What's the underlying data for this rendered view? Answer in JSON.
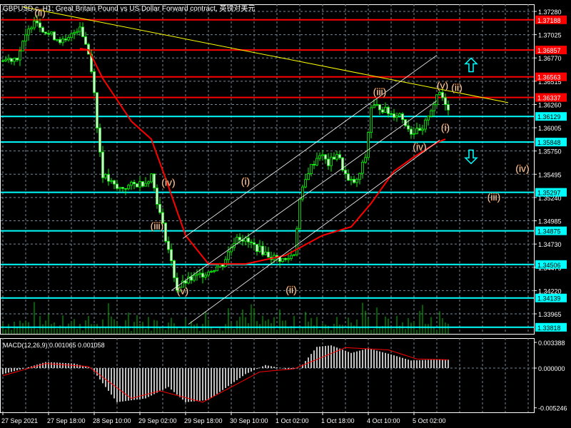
{
  "window_title": "GBPUSD.c, H1:  Great Britain Pound vs US Dollar Forward contract, 英镑对美元",
  "macd_label": "MACD(12,26,9) 0.001065 0.001058",
  "colors": {
    "bull": "#00ff00",
    "bear": "#ffffff",
    "ma": "#ff0000",
    "resistance": "#ff0000",
    "support": "#00ffff",
    "trend": "#ffff00",
    "channel": "#ffffff",
    "grid": "#778899",
    "wave": "#ffffff"
  },
  "chart_data": {
    "type": "candlestick",
    "symbol": "GBPUSD.c",
    "timeframe": "H1",
    "ylim": [
      1.337,
      1.3735
    ],
    "price_ticks": [
      "1.37280",
      "1.37025",
      "1.36770",
      "1.36515",
      "1.36260",
      "1.36005",
      "1.35750",
      "1.35495",
      "1.35240",
      "1.34985",
      "1.34730",
      "1.34475",
      "1.34220",
      "1.33965"
    ],
    "x_ticks": [
      {
        "bar": 0,
        "label": "27 Sep 2021"
      },
      {
        "bar": 16,
        "label": "27 Sep 18:00"
      },
      {
        "bar": 32,
        "label": "28 Sep 10:00"
      },
      {
        "bar": 48,
        "label": "29 Sep 02:00"
      },
      {
        "bar": 64,
        "label": "29 Sep 18:00"
      },
      {
        "bar": 80,
        "label": "30 Sep 10:00"
      },
      {
        "bar": 96,
        "label": "1 Oct 02:00"
      },
      {
        "bar": 112,
        "label": "1 Oct 18:00"
      },
      {
        "bar": 128,
        "label": "4 Oct 10:00"
      },
      {
        "bar": 144,
        "label": "5 Oct 02:00"
      }
    ],
    "price_path": [
      [
        0,
        1.3674
      ],
      [
        5,
        1.3678
      ],
      [
        11,
        1.3721
      ],
      [
        15,
        1.37053
      ],
      [
        22,
        1.36936
      ],
      [
        27,
        1.37131
      ],
      [
        30,
        1.36819
      ],
      [
        32,
        1.36428
      ],
      [
        33,
        1.35998
      ],
      [
        35,
        1.3549
      ],
      [
        40,
        1.35333
      ],
      [
        50,
        1.35411
      ],
      [
        52,
        1.3549
      ],
      [
        55,
        1.3506
      ],
      [
        58,
        1.34669
      ],
      [
        61,
        1.34239
      ],
      [
        64,
        1.34317
      ],
      [
        72,
        1.34434
      ],
      [
        77,
        1.34512
      ],
      [
        82,
        1.34825
      ],
      [
        86,
        1.34747
      ],
      [
        94,
        1.3459
      ],
      [
        99,
        1.34551
      ],
      [
        102,
        1.3463
      ],
      [
        104,
        1.35216
      ],
      [
        107,
        1.35529
      ],
      [
        111,
        1.35724
      ],
      [
        114,
        1.35607
      ],
      [
        117,
        1.35724
      ],
      [
        121,
        1.35411
      ],
      [
        124,
        1.35411
      ],
      [
        127,
        1.35685
      ],
      [
        129,
        1.36232
      ],
      [
        132,
        1.36232
      ],
      [
        136,
        1.36154
      ],
      [
        139,
        1.36154
      ],
      [
        143,
        1.35959
      ],
      [
        147,
        1.35959
      ],
      [
        149,
        1.36154
      ],
      [
        153,
        1.36389
      ],
      [
        156,
        1.36232
      ]
    ],
    "moving_average": [
      [
        27,
        1.36873
      ],
      [
        30,
        1.36858
      ],
      [
        35,
        1.36545
      ],
      [
        45,
        1.36076
      ],
      [
        52,
        1.3588
      ],
      [
        57,
        1.3545
      ],
      [
        64,
        1.34825
      ],
      [
        72,
        1.34512
      ],
      [
        85,
        1.34512
      ],
      [
        99,
        1.34606
      ],
      [
        112,
        1.34825
      ],
      [
        122,
        1.34919
      ],
      [
        129,
        1.35177
      ],
      [
        137,
        1.35529
      ],
      [
        144,
        1.35685
      ],
      [
        152,
        1.35841
      ],
      [
        155,
        1.3588
      ]
    ],
    "levels": [
      {
        "price": 1.37188,
        "label": "1.37188",
        "kind": "resistance"
      },
      {
        "price": 1.36857,
        "label": "1.36857",
        "kind": "resistance"
      },
      {
        "price": 1.36563,
        "label": "1.36563",
        "kind": "resistance"
      },
      {
        "price": 1.36337,
        "label": "1.36337",
        "kind": "resistance"
      },
      {
        "price": 1.36129,
        "label": "1.36129",
        "kind": "support"
      },
      {
        "price": 1.35848,
        "label": "1.35848",
        "kind": "support"
      },
      {
        "price": 1.35297,
        "label": "1.35297",
        "kind": "support"
      },
      {
        "price": 1.34875,
        "label": "1.34875",
        "kind": "support"
      },
      {
        "price": 1.34506,
        "label": "1.34506",
        "kind": "support"
      },
      {
        "price": 1.34139,
        "label": "1.34139",
        "kind": "support"
      },
      {
        "price": 1.33818,
        "label": "1.33818",
        "kind": "support"
      }
    ],
    "trendline": [
      [
        7,
        1.3733
      ],
      [
        177,
        1.3628
      ]
    ],
    "channel": [
      [
        [
          63,
          1.3479
        ],
        [
          152,
          1.368
        ]
      ],
      [
        [
          59,
          1.3422
        ],
        [
          152,
          1.363
        ]
      ],
      [
        [
          65,
          1.3385
        ],
        [
          153,
          1.3587
        ]
      ]
    ],
    "wave_labels": [
      {
        "text": "(ii)",
        "bar": 13,
        "price": 1.3723
      },
      {
        "text": "(iv)",
        "bar": 58,
        "price": 1.3537
      },
      {
        "text": "(iii)",
        "bar": 54,
        "price": 1.3489
      },
      {
        "text": "(v)",
        "bar": 63,
        "price": 1.3418
      },
      {
        "text": "(i)",
        "bar": 85,
        "price": 1.3538
      },
      {
        "text": "(ii)",
        "bar": 101,
        "price": 1.3419
      },
      {
        "text": "(iii)",
        "bar": 132,
        "price": 1.3636
      },
      {
        "text": "(iv)",
        "bar": 146,
        "price": 1.3576
      },
      {
        "text": "(v)",
        "bar": 154,
        "price": 1.3643
      },
      {
        "text": "(ii)",
        "bar": 159,
        "price": 1.3641
      },
      {
        "text": "(i)",
        "bar": 155,
        "price": 1.3597
      },
      {
        "text": "(iv)",
        "bar": 182,
        "price": 1.3552
      },
      {
        "text": "(iii)",
        "bar": 172,
        "price": 1.3521
      }
    ],
    "arrows": [
      {
        "dir": "up",
        "bar": 164,
        "price": 1.3669
      },
      {
        "dir": "down",
        "bar": 164,
        "price": 1.3569
      }
    ],
    "macd": {
      "params": "12,26,9",
      "main": 0.001065,
      "signal_value": 0.001058,
      "ylim": [
        -0.005246,
        0.003388
      ],
      "ticks": [
        "0.003388",
        "0.000000",
        "-0.005246"
      ],
      "histogram": [
        [
          0,
          -0.0008
        ],
        [
          8,
          0
        ],
        [
          15,
          0.0008
        ],
        [
          25,
          0.0006
        ],
        [
          31,
          0
        ],
        [
          40,
          -0.0045
        ],
        [
          50,
          -0.004
        ],
        [
          58,
          -0.0025
        ],
        [
          64,
          -0.0045
        ],
        [
          72,
          -0.0042
        ],
        [
          85,
          -0.0008
        ],
        [
          92,
          0.0004
        ],
        [
          100,
          -0.0002
        ],
        [
          104,
          0
        ],
        [
          110,
          0.0028
        ],
        [
          115,
          0.003
        ],
        [
          122,
          0.002
        ],
        [
          128,
          0.0026
        ],
        [
          136,
          0.0018
        ],
        [
          143,
          0.001
        ],
        [
          150,
          0.0011
        ],
        [
          156,
          0.0011
        ]
      ],
      "signal": [
        [
          0,
          -0.001
        ],
        [
          15,
          0.0006
        ],
        [
          30,
          0.0002
        ],
        [
          45,
          -0.004
        ],
        [
          55,
          -0.003
        ],
        [
          70,
          -0.0045
        ],
        [
          90,
          -0.0005
        ],
        [
          102,
          -0.0001
        ],
        [
          120,
          0.0027
        ],
        [
          135,
          0.0024
        ],
        [
          145,
          0.0012
        ],
        [
          156,
          0.0011
        ]
      ]
    }
  }
}
